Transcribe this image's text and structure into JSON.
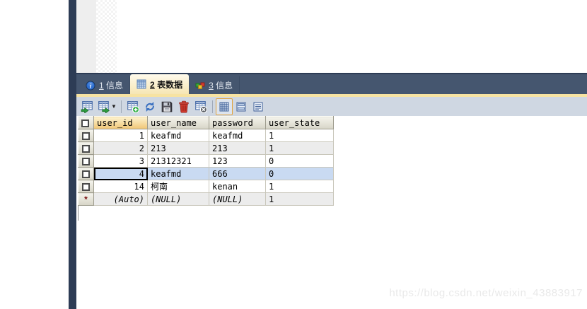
{
  "tabs": {
    "items": [
      {
        "num": "1",
        "label": "信息",
        "icon": "info-icon",
        "active": false
      },
      {
        "num": "2",
        "label": "表数据",
        "icon": "table-grid-icon",
        "active": true
      },
      {
        "num": "3",
        "label": "信息",
        "icon": "colored-cubes-icon",
        "active": false
      }
    ]
  },
  "toolbar": {
    "icons": [
      "import-table-icon",
      "export-table-icon",
      "dropdown-caret-icon",
      "add-row-icon",
      "refresh-icon",
      "save-icon",
      "delete-row-icon",
      "cancel-changes-icon",
      "grid-view-icon",
      "form-view-icon",
      "text-view-icon"
    ],
    "active_view": "grid-view",
    "dropdown_caret": "▼"
  },
  "grid": {
    "columns": [
      "user_id",
      "user_name",
      "password",
      "user_state"
    ],
    "rows": [
      {
        "cells": [
          "1",
          "keafmd",
          "keafmd",
          "1"
        ]
      },
      {
        "cells": [
          "2",
          "213",
          "213",
          "1"
        ]
      },
      {
        "cells": [
          "3",
          "21312321",
          "123",
          "0"
        ]
      },
      {
        "cells": [
          "4",
          "keafmd",
          "666",
          "0"
        ]
      },
      {
        "cells": [
          "14",
          "柯南",
          "kenan",
          "1"
        ]
      },
      {
        "marker": "*",
        "cells": [
          "(Auto)",
          "(NULL)",
          "(NULL)",
          "1"
        ]
      }
    ],
    "selected_row_index": 3,
    "active_cell_column": "user_id"
  },
  "colors": {
    "sidebar_navy": "#2d3c55",
    "tabbar_navy": "#45566f",
    "active_tab_cream": "#f6e6b4",
    "toolbar_gray_blue": "#cfd7e2",
    "sorted_column_orange": "#f0c675",
    "selected_row_blue": "#c9daf2"
  },
  "watermark": "https://blog.csdn.net/weixin_43883917"
}
